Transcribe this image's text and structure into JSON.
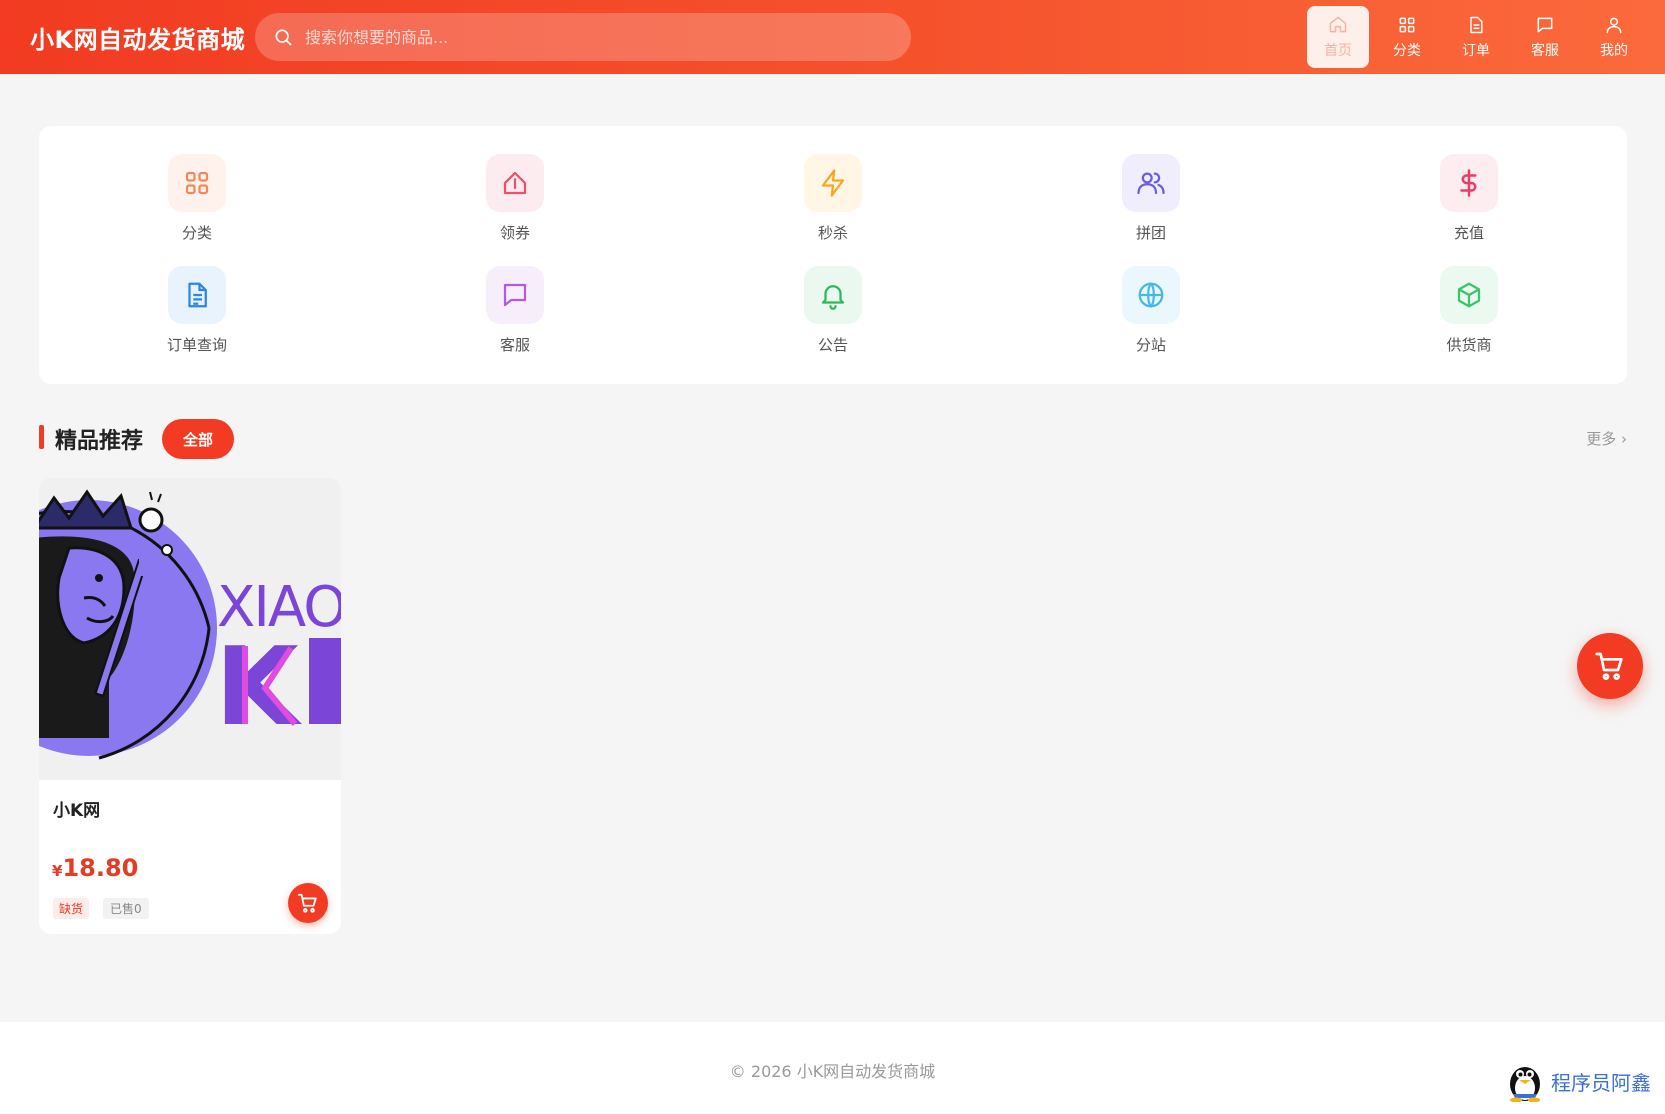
{
  "header": {
    "logo": "小K网自动发货商城",
    "search_placeholder": "搜索你想要的商品...",
    "nav": [
      {
        "label": "首页",
        "icon": "home-icon",
        "active": true
      },
      {
        "label": "分类",
        "icon": "grid-icon"
      },
      {
        "label": "订单",
        "icon": "document-icon"
      },
      {
        "label": "客服",
        "icon": "chat-icon"
      },
      {
        "label": "我的",
        "icon": "user-icon"
      }
    ]
  },
  "quick_entries": [
    {
      "label": "分类",
      "icon": "grid-icon",
      "color": "#f08a5d",
      "bg": "#fff2ec"
    },
    {
      "label": "领券",
      "icon": "coupon-icon",
      "color": "#ef4f6a",
      "bg": "#fdecef"
    },
    {
      "label": "秒杀",
      "icon": "lightning-icon",
      "color": "#f5a623",
      "bg": "#fff6e6"
    },
    {
      "label": "拼团",
      "icon": "users-icon",
      "color": "#6a5ee6",
      "bg": "#f0eefc"
    },
    {
      "label": "充值",
      "icon": "dollar-icon",
      "color": "#ef3b63",
      "bg": "#fdecf0"
    },
    {
      "label": "订单查询",
      "icon": "file-text-icon",
      "color": "#2b86e8",
      "bg": "#e9f3fd"
    },
    {
      "label": "客服",
      "icon": "message-icon",
      "color": "#b458e0",
      "bg": "#f7eefc"
    },
    {
      "label": "公告",
      "icon": "bell-icon",
      "color": "#2fb85a",
      "bg": "#eaf8ef"
    },
    {
      "label": "分站",
      "icon": "globe-icon",
      "color": "#45b8e6",
      "bg": "#eaf7fd"
    },
    {
      "label": "供货商",
      "icon": "cube-icon",
      "color": "#3cc46a",
      "bg": "#ebf9f0"
    }
  ],
  "section": {
    "title": "精品推荐",
    "tag": "全部",
    "more": "更多 ›"
  },
  "products": [
    {
      "name": "小K网",
      "currency": "¥",
      "price": "18.80",
      "stock_badge": "缺货",
      "sold": "已售0",
      "image_text_1": "XIAO",
      "image_text_2": "K"
    }
  ],
  "footer": {
    "copyright": "© 2026 小K网自动发货商城",
    "watermark": "程序员阿鑫"
  },
  "colors": {
    "brand": "#f23b22",
    "price": "#e53b24"
  }
}
